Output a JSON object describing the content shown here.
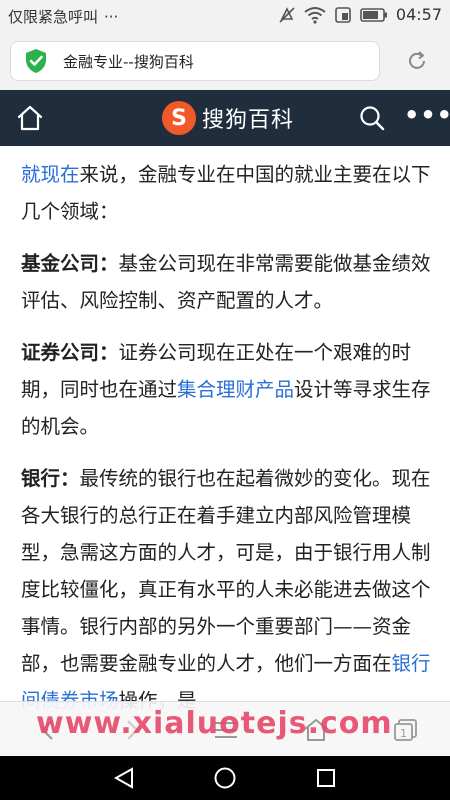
{
  "status_bar": {
    "carrier_text": "仅限紧急呼叫",
    "more_glyph": "···",
    "time": "04:57"
  },
  "browser": {
    "tab_title": "金融专业--搜狗百科"
  },
  "site": {
    "logo_letter": "S",
    "logo_text": "搜狗百科",
    "more_glyph": "•••"
  },
  "article": {
    "intro_link": "就现在",
    "intro_text": "来说，金融专业在中国的就业主要在以下几个领域：",
    "sections": [
      {
        "term": "基金公司：",
        "text_before": "基金公司现在非常需要能做基金绩效评估、风险控制、资产配置的人才。",
        "link": "",
        "text_after": ""
      },
      {
        "term": "证券公司：",
        "text_before": "证券公司现在正处在一个艰难的时期，同时也在通过",
        "link": "集合理财产品",
        "text_after": "设计等寻求生存的机会。"
      },
      {
        "term": "银行：",
        "text_before": "最传统的银行也在起着微妙的变化。现在各大银行的总行正在着手建立内部风险管理模型，急需这方面的人才，可是，由于银行用人制度比较僵化，真正有水平的人未必能进去做这个事情。银行内部的另外一个重要部门——资金部，也需要金融专业的人才，他们一方面在",
        "link": "银行间债券市场",
        "text_after": "操作，是"
      }
    ]
  },
  "watermark": "www.xialuotejs.com"
}
